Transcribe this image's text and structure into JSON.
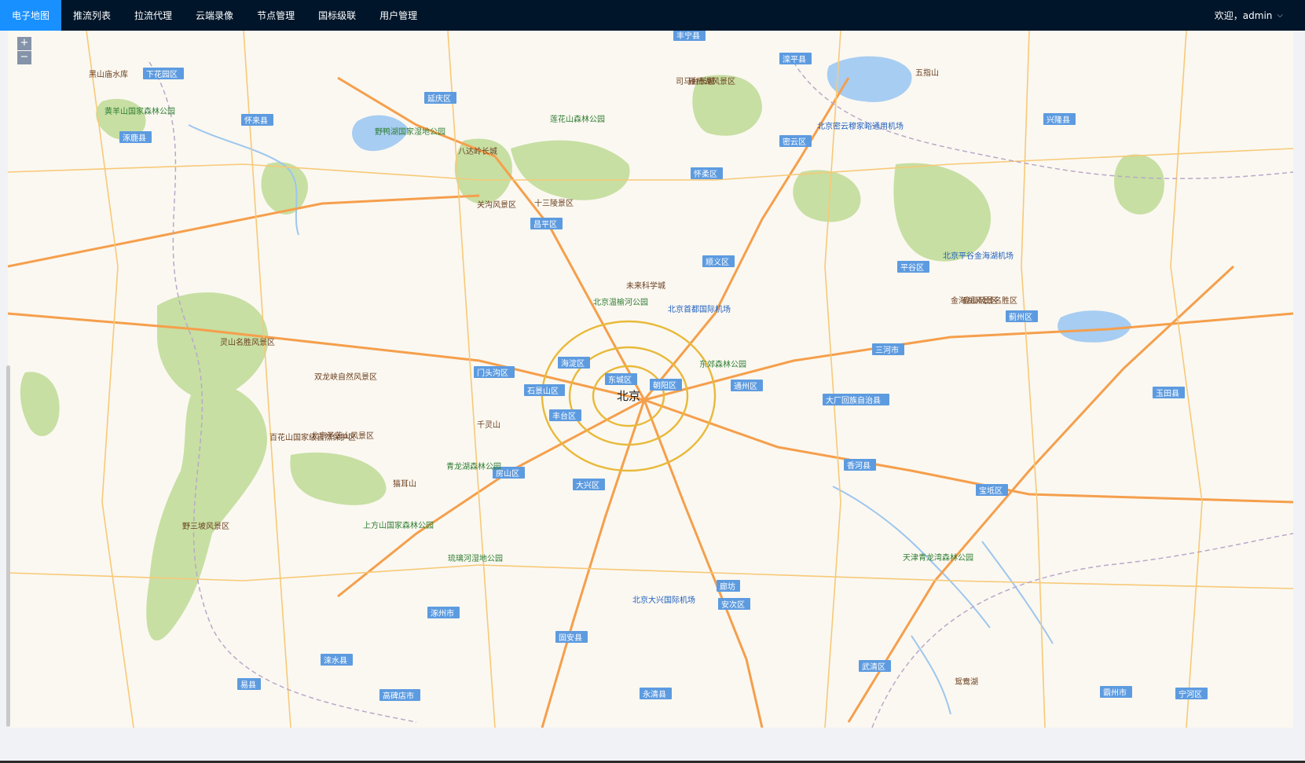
{
  "nav": {
    "items": [
      {
        "label": "电子地图",
        "active": true
      },
      {
        "label": "推流列表"
      },
      {
        "label": "拉流代理"
      },
      {
        "label": "云端录像"
      },
      {
        "label": "节点管理"
      },
      {
        "label": "国标级联"
      },
      {
        "label": "用户管理"
      }
    ]
  },
  "user": {
    "greeting": "欢迎，admin",
    "caret_icon": "chevron-down-icon"
  },
  "map": {
    "zoom_in": "+",
    "zoom_out": "−",
    "center_label": "北京",
    "colors": {
      "land": "#fbf8f1",
      "park": "#c7dfa3",
      "water": "#a7cdf2",
      "highway": "#f59f4c",
      "major_road": "#f7c978",
      "ring_road": "#e8b93a"
    },
    "districts": [
      "怀柔区",
      "密云区",
      "昌平区",
      "顺义区",
      "平谷区",
      "延庆区",
      "门头沟区",
      "石景山区",
      "海淀区",
      "东城区",
      "丰台区",
      "朝阳区",
      "通州区",
      "房山区",
      "大兴区",
      "三河市",
      "香河县",
      "廊坊",
      "安次区",
      "固安县",
      "永清县",
      "涿州市",
      "涞水县",
      "易县",
      "高碑店市",
      "武清区",
      "宝坻区",
      "蓟州区",
      "兴隆县",
      "滦平县",
      "丰宁县",
      "怀来县",
      "涿鹿县",
      "下花园区",
      "大厂回族自治县",
      "玉田县",
      "宁河区",
      "霸州市"
    ],
    "places": [
      "北京首都国际机场",
      "北京大兴国际机场",
      "北京平谷金海湖机场",
      "北京密云穆家峪通用机场",
      "未来科学城",
      "北京温榆河公园",
      "东郊森林公园",
      "黑山庙水库",
      "黄羊山国家森林公园",
      "野鸭湖国家湿地公园",
      "莲花山森林公园",
      "雁栖湖风景区",
      "八达岭长城",
      "关沟风景区",
      "十三陵景区",
      "百花山国家级自然保护区",
      "灵山名胜风景区",
      "双龙峡自然风景区",
      "北京圣莲山风景区",
      "青龙湖森林公园",
      "琉璃河湿地公园",
      "上方山国家森林公园",
      "野三坡风景区",
      "天津青龙湾森林公园",
      "金海湖风景区",
      "盘山风景名胜区",
      "司马台长城",
      "猫耳山",
      "千灵山",
      "鸳鸯湖",
      "五指山"
    ]
  }
}
